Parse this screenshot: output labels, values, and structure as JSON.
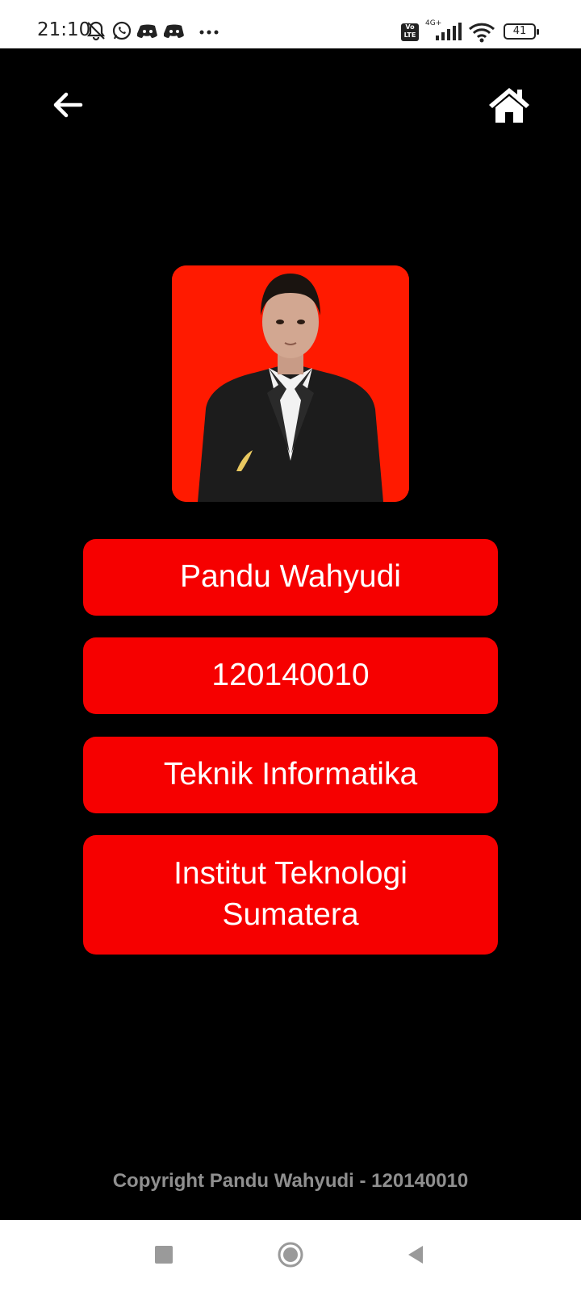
{
  "status_bar": {
    "time": "21:10",
    "network_top": "4G+",
    "volte": "Vo LTE",
    "battery": "41",
    "icons": [
      "notifications-off-icon",
      "whatsapp-icon",
      "discord-icon",
      "discord-icon",
      "more-dots-icon",
      "volte-icon",
      "signal-icon",
      "wifi-icon",
      "battery-icon"
    ]
  },
  "top_bar": {
    "back_icon": "arrow-left-icon",
    "home_icon": "home-icon"
  },
  "profile": {
    "photo_background": "#ff1a00",
    "name": "Pandu Wahyudi",
    "nim": "120140010",
    "major": "Teknik Informatika",
    "campus": "Institut Teknologi Sumatera"
  },
  "footer": {
    "copyright": "Copyright Pandu Wahyudi - 120140010"
  },
  "nav_bar": {
    "icons": [
      "recents-square-icon",
      "home-circle-icon",
      "back-triangle-icon"
    ]
  },
  "colors": {
    "background": "#000000",
    "card": "#f60000",
    "footer_text": "#8f8f8f"
  }
}
